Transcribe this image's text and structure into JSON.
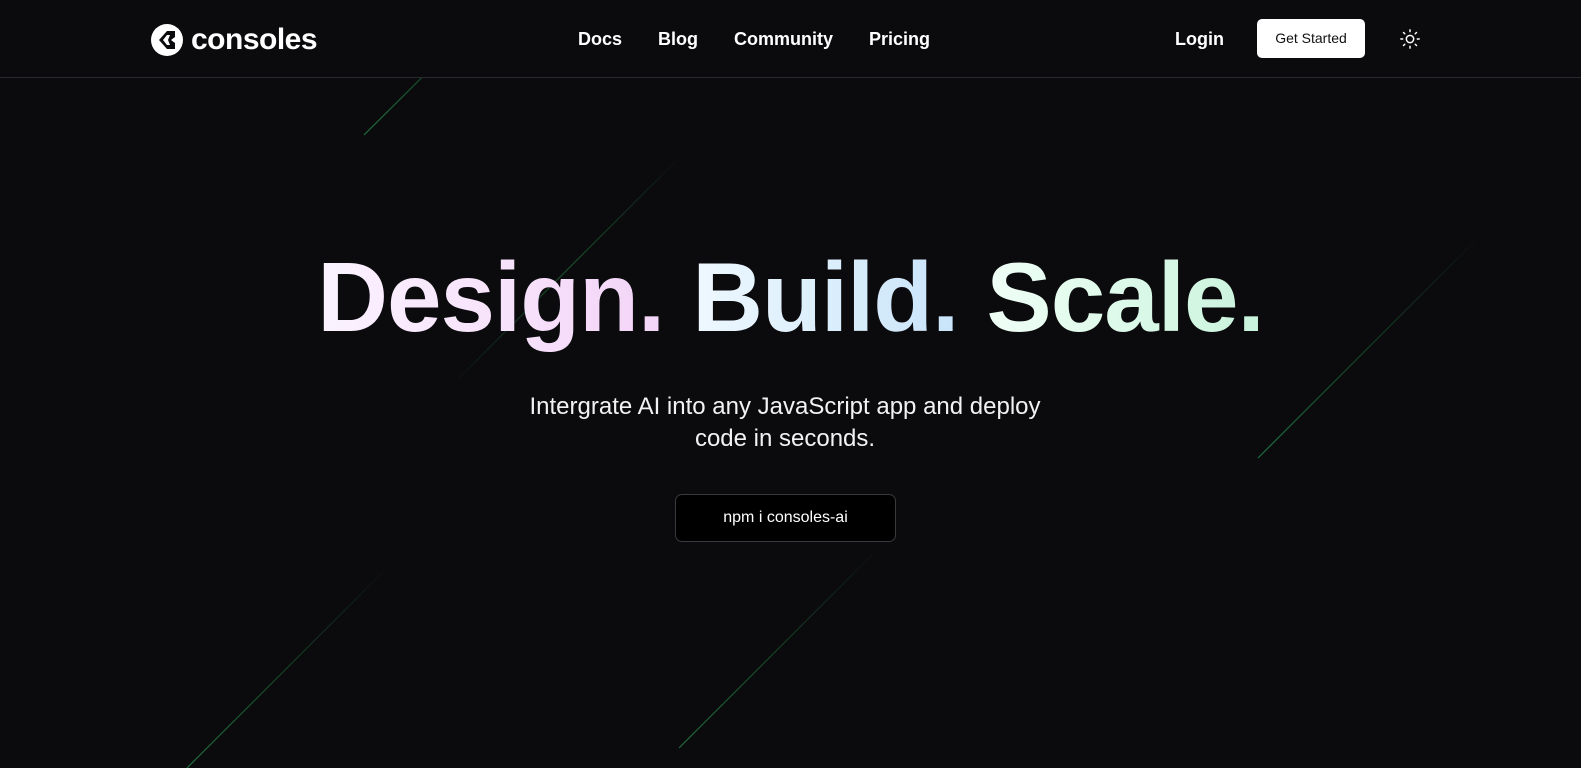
{
  "brand": {
    "name": "consoles",
    "logo_icon": "consoles-logo-icon"
  },
  "nav": {
    "items": [
      {
        "label": "Docs"
      },
      {
        "label": "Blog"
      },
      {
        "label": "Community"
      },
      {
        "label": "Pricing"
      }
    ],
    "login_label": "Login",
    "cta_label": "Get Started",
    "theme_icon": "sun-icon"
  },
  "hero": {
    "title_words": [
      "Design.",
      "Build.",
      "Scale."
    ],
    "subtitle_line1": "Intergrate AI into any JavaScript app and deploy",
    "subtitle_line2": "code in seconds.",
    "install_command": "npm i consoles-ai"
  },
  "colors": {
    "background": "#0b0b0d",
    "header_border": "#2a2a2e",
    "accent_streak": "#1f7a43",
    "title_gradient_1": [
      "#fbf3ff",
      "#f3d4f7"
    ],
    "title_gradient_2": [
      "#eef8ff",
      "#c9e4f9"
    ],
    "title_gradient_3": [
      "#f0fff6",
      "#c8f3dc"
    ]
  }
}
